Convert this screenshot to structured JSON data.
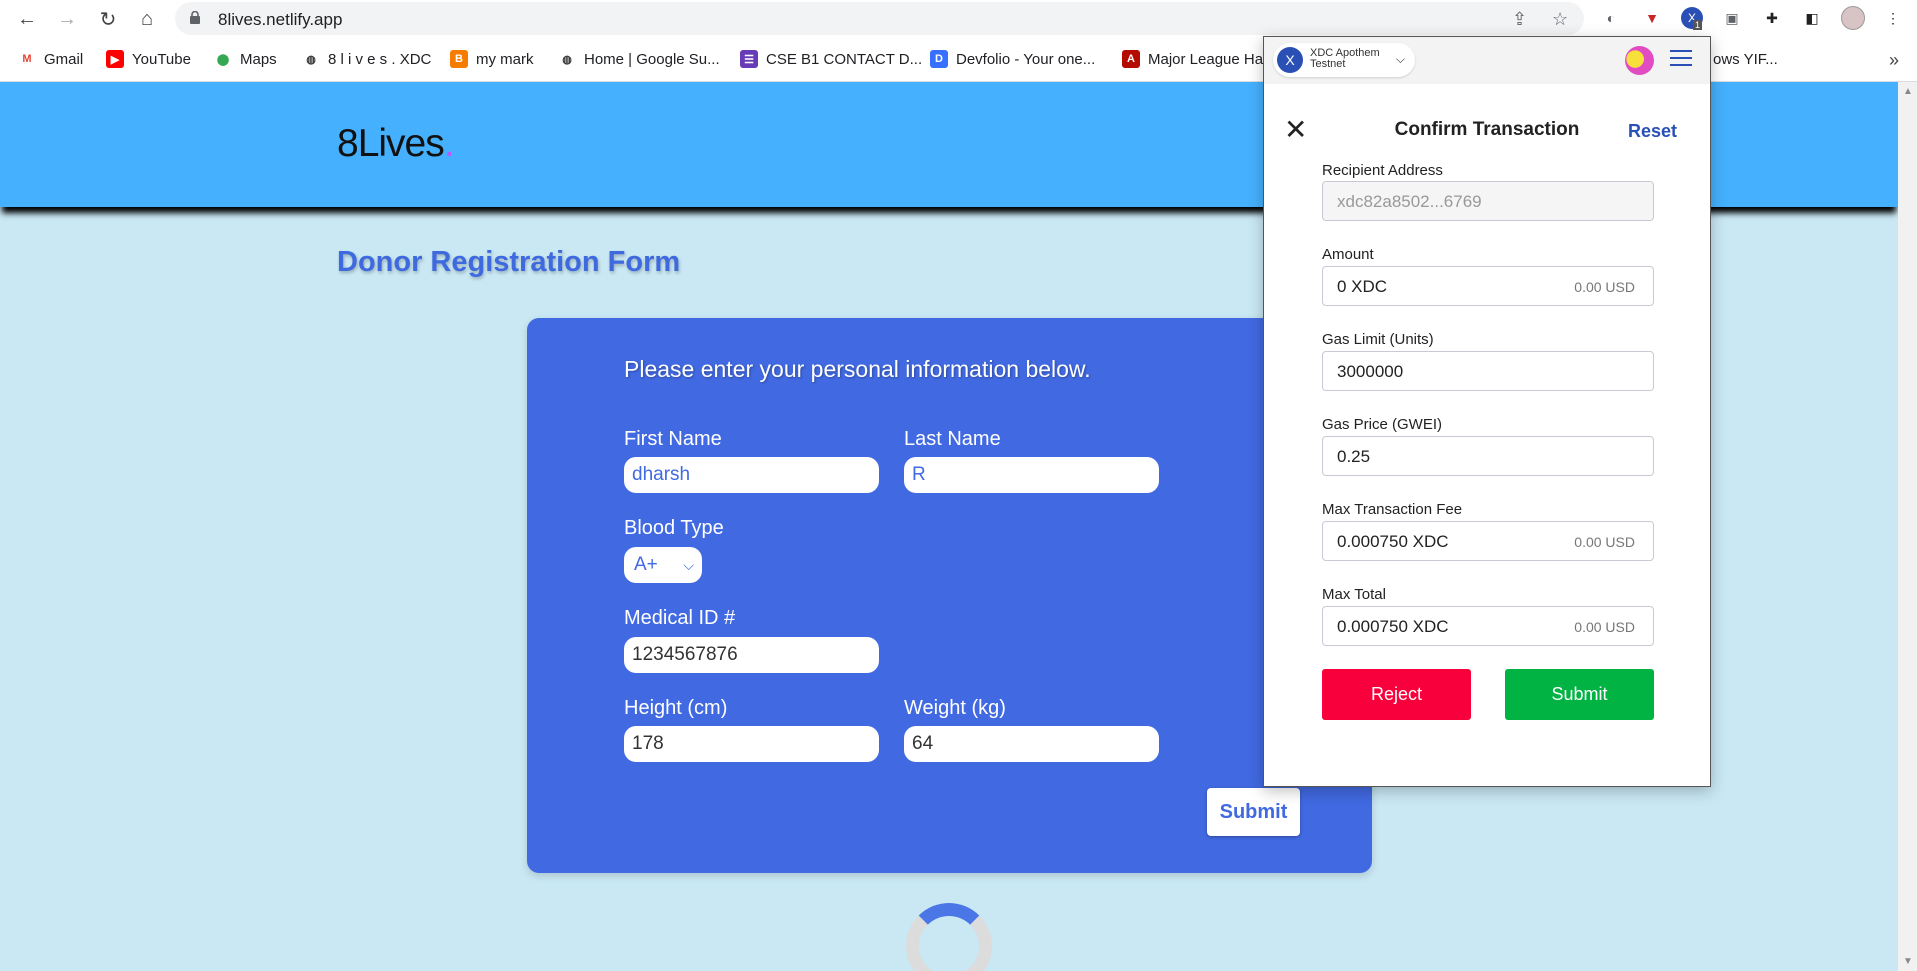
{
  "browser": {
    "url": "8lives.netlify.app",
    "ext_badge": "1",
    "ext_letter": "X",
    "bookmarks": [
      {
        "label": "Gmail",
        "icon": "gmail-icon",
        "color": "#ea4335",
        "glyph": "M"
      },
      {
        "label": "YouTube",
        "icon": "youtube-icon",
        "color": "#ff0000",
        "glyph": "▶"
      },
      {
        "label": "Maps",
        "icon": "maps-icon",
        "color": "#34a853",
        "glyph": "◉"
      },
      {
        "label": "8 l i v e s . XDC",
        "icon": "globe-icon",
        "color": "#333333",
        "glyph": "◍"
      },
      {
        "label": "my mark",
        "icon": "blogger-icon",
        "color": "#f57c00",
        "glyph": "B"
      },
      {
        "label": "Home | Google Su...",
        "icon": "globe-icon",
        "color": "#333333",
        "glyph": "◍"
      },
      {
        "label": "CSE B1 CONTACT D...",
        "icon": "forms-icon",
        "color": "#673ab7",
        "glyph": "☰"
      },
      {
        "label": "Devfolio - Your one...",
        "icon": "devfolio-icon",
        "color": "#3770ff",
        "glyph": "D"
      },
      {
        "label": "Major League Ha",
        "icon": "pdf-icon",
        "color": "#b30b00",
        "glyph": "A"
      },
      {
        "label": "ows YIF...",
        "icon": "",
        "color": "",
        "glyph": ""
      }
    ]
  },
  "site": {
    "logo": "8Lives",
    "logo_dot": ".",
    "page_title": "Donor Registration Form"
  },
  "form": {
    "intro": "Please enter your personal information below.",
    "first_name_label": "First Name",
    "first_name_value": "dharsh",
    "last_name_label": "Last Name",
    "last_name_value": "R",
    "blood_type_label": "Blood Type",
    "blood_type_value": "A+",
    "medical_id_label": "Medical ID #",
    "medical_id_value": "1234567876",
    "height_label": "Height (cm)",
    "height_value": "178",
    "weight_label": "Weight (kg)",
    "weight_value": "64",
    "submit_label": "Submit"
  },
  "wallet": {
    "network_line1": "XDC Apothem",
    "network_line2": "Testnet",
    "network_logo": "X",
    "title": "Confirm Transaction",
    "reset_label": "Reset",
    "close_glyph": "✕",
    "recipient_label": "Recipient Address",
    "recipient_value": "xdc82a8502...6769",
    "amount_label": "Amount",
    "amount_value": "0 XDC",
    "amount_usd": "0.00 USD",
    "gas_limit_label": "Gas Limit (Units)",
    "gas_limit_value": "3000000",
    "gas_price_label": "Gas Price (GWEI)",
    "gas_price_value": "0.25",
    "max_fee_label": "Max Transaction Fee",
    "max_fee_value": "0.000750 XDC",
    "max_fee_usd": "0.00 USD",
    "max_total_label": "Max Total",
    "max_total_value": "0.000750 XDC",
    "max_total_usd": "0.00 USD",
    "reject_label": "Reject",
    "submit_label": "Submit",
    "colors": {
      "reject": "#f8003c",
      "submit": "#00b342",
      "accent": "#2a4fb5"
    }
  }
}
